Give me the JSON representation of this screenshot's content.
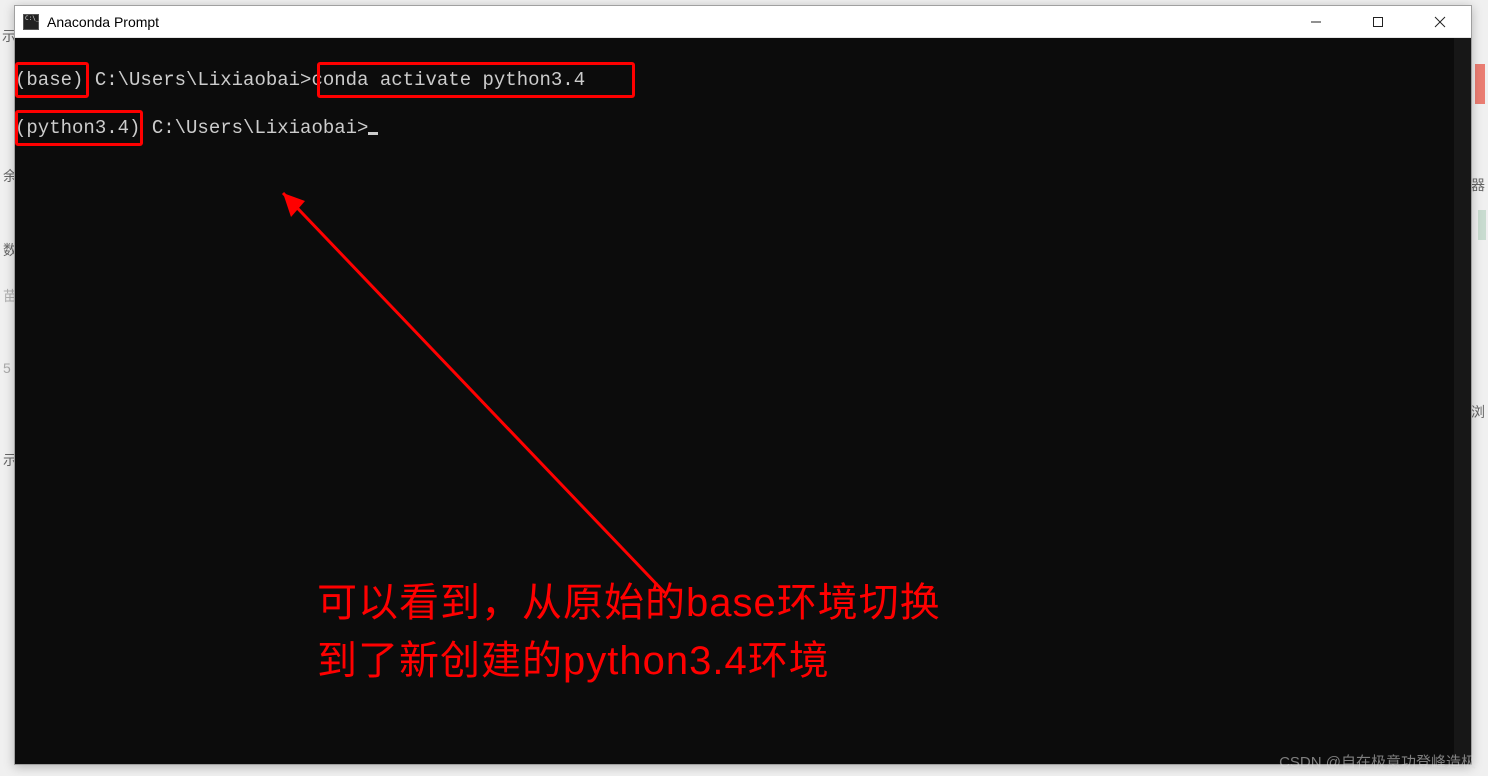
{
  "bg": {
    "l1": "示",
    "l2": "余",
    "l3": "数",
    "l4": "苗",
    "l5": "5",
    "l6": "",
    "l7": "示",
    "r2": "器",
    "r4": "浏"
  },
  "window": {
    "title": "Anaconda Prompt"
  },
  "terminal": {
    "line1_env": "(base)",
    "line1_path": " C:\\Users\\Lixiaobai>",
    "line1_cmd": "conda activate python3.4",
    "line2_env": "(python3.4)",
    "line2_path": " C:\\Users\\Lixiaobai>"
  },
  "annotation": {
    "line1": "可以看到，从原始的base环境切换",
    "line2": "到了新创建的python3.4环境"
  },
  "watermark": "CSDN @自在极意功登峰造极"
}
